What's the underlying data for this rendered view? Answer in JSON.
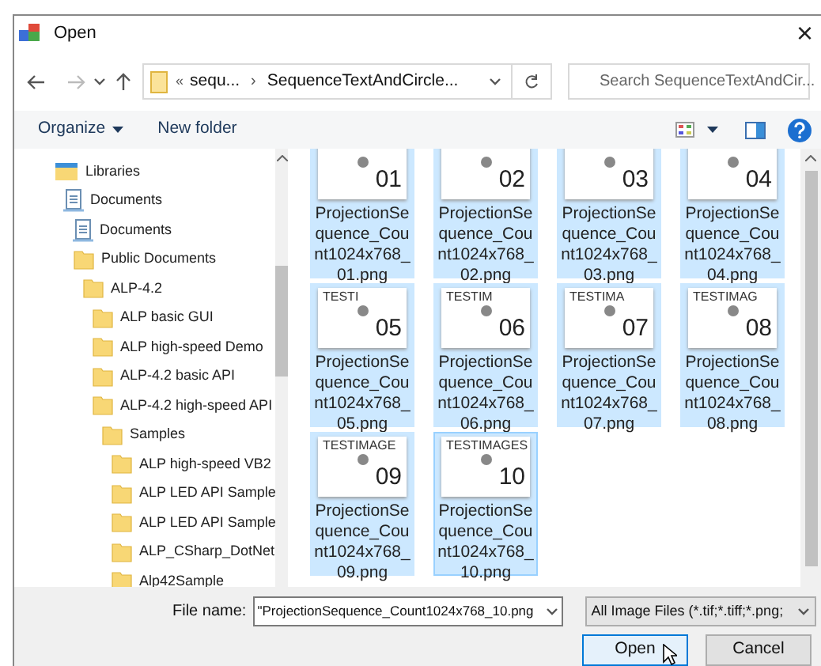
{
  "window": {
    "title": "Open",
    "close": "×"
  },
  "navigation": {
    "breadcrumb_prefix": "«",
    "path": [
      {
        "label": "sequ..."
      },
      {
        "label": "SequenceTextAndCircle..."
      }
    ],
    "separator": "›",
    "search": {
      "placeholder": "Search SequenceTextAndCir..."
    }
  },
  "toolbar": {
    "organize": "Organize",
    "new_folder": "New folder"
  },
  "sidebar": {
    "items": [
      {
        "label": "Libraries",
        "kind": "library",
        "children": [
          {
            "label": "Documents",
            "kind": "documents",
            "children": [
              {
                "label": "Documents",
                "kind": "documents"
              },
              {
                "label": "Public Documents",
                "kind": "folder",
                "children": [
                  {
                    "label": "ALP-4.2",
                    "kind": "folder",
                    "children": [
                      {
                        "label": "ALP basic GUI",
                        "kind": "folder"
                      },
                      {
                        "label": "ALP high-speed Demo",
                        "kind": "folder"
                      },
                      {
                        "label": "ALP-4.2 basic API",
                        "kind": "folder"
                      },
                      {
                        "label": "ALP-4.2 high-speed API",
                        "kind": "folder",
                        "children": [
                          {
                            "label": "Samples",
                            "kind": "folder",
                            "children": [
                              {
                                "label": "ALP high-speed VB2",
                                "kind": "folder"
                              },
                              {
                                "label": "ALP LED API Sample",
                                "kind": "folder"
                              },
                              {
                                "label": "ALP LED API Sample",
                                "kind": "folder"
                              },
                              {
                                "label": "ALP_CSharp_DotNet",
                                "kind": "folder"
                              },
                              {
                                "label": "Alp42Sample",
                                "kind": "folder"
                              }
                            ]
                          }
                        ]
                      }
                    ]
                  }
                ]
              }
            ]
          }
        ]
      }
    ]
  },
  "files": [
    {
      "number": "01",
      "name": "ProjectionSequence_Count1024x768_01.png",
      "selected": true,
      "focused": false
    },
    {
      "number": "02",
      "name": "ProjectionSequence_Count1024x768_02.png",
      "selected": true,
      "focused": false
    },
    {
      "number": "03",
      "name": "ProjectionSequence_Count1024x768_03.png",
      "selected": true,
      "focused": false
    },
    {
      "number": "04",
      "name": "ProjectionSequence_Count1024x768_04.png",
      "selected": true,
      "focused": false
    },
    {
      "caption": "TESTI",
      "number": "05",
      "name": "ProjectionSequence_Count1024x768_05.png",
      "selected": true,
      "focused": false
    },
    {
      "caption": "TESTIM",
      "number": "06",
      "name": "ProjectionSequence_Count1024x768_06.png",
      "selected": true,
      "focused": false
    },
    {
      "caption": "TESTIMA",
      "number": "07",
      "name": "ProjectionSequence_Count1024x768_07.png",
      "selected": true,
      "focused": false
    },
    {
      "caption": "TESTIMAG",
      "number": "08",
      "name": "ProjectionSequence_Count1024x768_08.png",
      "selected": true,
      "focused": false
    },
    {
      "caption": "TESTIMAGE",
      "number": "09",
      "name": "ProjectionSequence_Count1024x768_09.png",
      "selected": true,
      "focused": false
    },
    {
      "caption": "TESTIMAGES",
      "number": "10",
      "name": "ProjectionSequence_Count1024x768_10.png",
      "selected": true,
      "focused": true
    }
  ],
  "footer": {
    "file_name_label": "File name:",
    "file_name": "\"ProjectionSequence_Count1024x768_10.png",
    "file_type": "All Image Files (*.tif;*.tiff;*.png;",
    "open": "Open",
    "cancel": "Cancel"
  }
}
